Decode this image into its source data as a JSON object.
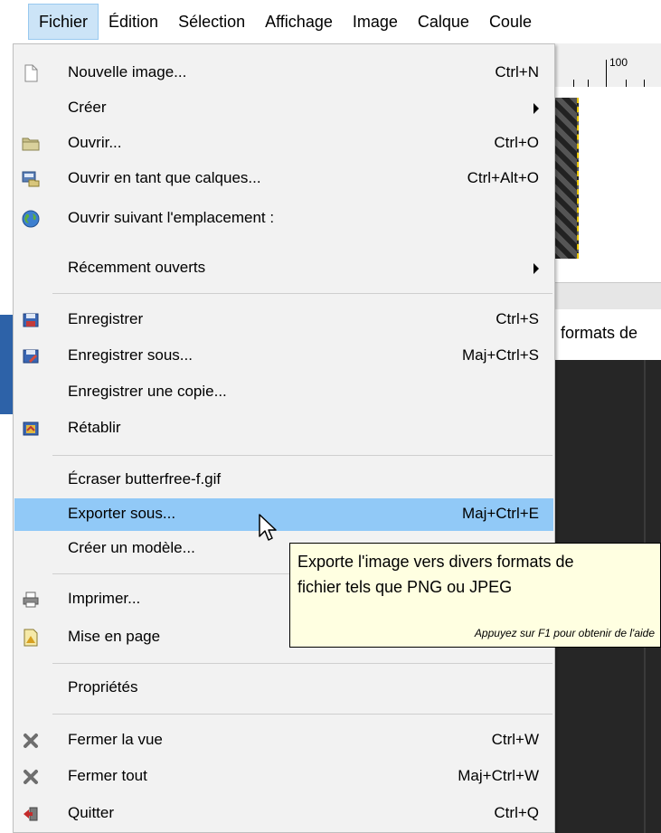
{
  "menubar": {
    "items": [
      {
        "label": "Fichier"
      },
      {
        "label": "Édition"
      },
      {
        "label": "Sélection"
      },
      {
        "label": "Affichage"
      },
      {
        "label": "Image"
      },
      {
        "label": "Calque"
      },
      {
        "label": "Coule"
      }
    ]
  },
  "background": {
    "ruler_label": "100",
    "hint_text": "formats de"
  },
  "menu": {
    "items": [
      {
        "label": "Nouvelle image...",
        "shortcut": "Ctrl+N",
        "icon": "new-image-icon"
      },
      {
        "label": "Créer",
        "shortcut": "",
        "icon": ""
      },
      {
        "label": "Ouvrir...",
        "shortcut": "Ctrl+O",
        "icon": "folder-open-icon"
      },
      {
        "label": "Ouvrir en tant que calques...",
        "shortcut": "Ctrl+Alt+O",
        "icon": "open-as-layers-icon"
      },
      {
        "label": "Ouvrir suivant l'emplacement :",
        "shortcut": "",
        "icon": "globe-icon"
      },
      {
        "label": "Récemment ouverts",
        "shortcut": "",
        "icon": ""
      },
      {
        "label": "Enregistrer",
        "shortcut": "Ctrl+S",
        "icon": "save-icon"
      },
      {
        "label": "Enregistrer sous...",
        "shortcut": "Maj+Ctrl+S",
        "icon": "save-as-icon"
      },
      {
        "label": "Enregistrer une copie...",
        "shortcut": "",
        "icon": ""
      },
      {
        "label": "Rétablir",
        "shortcut": "",
        "icon": "revert-icon"
      },
      {
        "label": "Écraser butterfree-f.gif",
        "shortcut": "",
        "icon": ""
      },
      {
        "label": "Exporter sous...",
        "shortcut": "Maj+Ctrl+E",
        "icon": ""
      },
      {
        "label": "Créer un modèle...",
        "shortcut": "",
        "icon": ""
      },
      {
        "label": "Imprimer...",
        "shortcut": "",
        "icon": "printer-icon"
      },
      {
        "label": "Mise en page",
        "shortcut": "",
        "icon": "page-setup-icon"
      },
      {
        "label": "Propriétés",
        "shortcut": "",
        "icon": ""
      },
      {
        "label": "Fermer la vue",
        "shortcut": "Ctrl+W",
        "icon": "close-view-icon"
      },
      {
        "label": "Fermer tout",
        "shortcut": "Maj+Ctrl+W",
        "icon": "close-all-icon"
      },
      {
        "label": "Quitter",
        "shortcut": "Ctrl+Q",
        "icon": "quit-icon"
      }
    ]
  },
  "tooltip": {
    "line1": "Exporte l'image vers divers formats de",
    "line2": "fichier tels que PNG ou JPEG",
    "help_hint": "Appuyez sur F1 pour obtenir de l'aide"
  },
  "colors": {
    "menu_bg": "#f2f2f2",
    "highlight": "#91c9f7",
    "menubar_active": "#cce4f7",
    "tooltip_bg": "#ffffe1"
  }
}
